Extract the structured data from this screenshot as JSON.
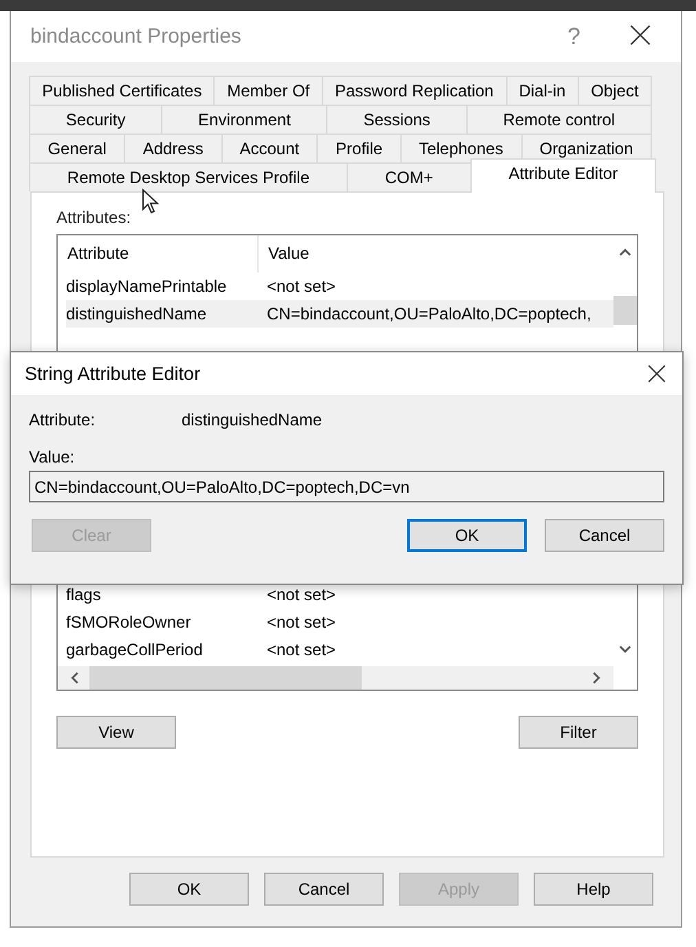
{
  "window": {
    "title": "bindaccount Properties",
    "help_button": "?"
  },
  "tab_rows": [
    {
      "tabs": [
        {
          "label": "Published Certificates",
          "selected": false
        },
        {
          "label": "Member Of",
          "selected": false
        },
        {
          "label": "Password Replication",
          "selected": false
        },
        {
          "label": "Dial-in",
          "selected": false
        },
        {
          "label": "Object",
          "selected": false
        }
      ]
    },
    {
      "tabs": [
        {
          "label": "Security",
          "selected": false
        },
        {
          "label": "Environment",
          "selected": false
        },
        {
          "label": "Sessions",
          "selected": false
        },
        {
          "label": "Remote control",
          "selected": false
        }
      ]
    },
    {
      "tabs": [
        {
          "label": "General",
          "selected": false
        },
        {
          "label": "Address",
          "selected": false
        },
        {
          "label": "Account",
          "selected": false
        },
        {
          "label": "Profile",
          "selected": false
        },
        {
          "label": "Telephones",
          "selected": false
        },
        {
          "label": "Organization",
          "selected": false
        }
      ]
    },
    {
      "tabs": [
        {
          "label": "Remote Desktop Services Profile",
          "selected": false
        },
        {
          "label": "COM+",
          "selected": false
        },
        {
          "label": "Attribute Editor",
          "selected": true
        }
      ]
    }
  ],
  "attributes": {
    "label": "Attributes:",
    "columns": [
      "Attribute",
      "Value"
    ],
    "rows_top": [
      {
        "attribute": "displayNamePrintable",
        "value": "<not set>",
        "selected": false
      },
      {
        "attribute": "distinguishedName",
        "value": "CN=bindaccount,OU=PaloAlto,DC=poptech,",
        "selected": true
      }
    ],
    "rows_bottom": [
      {
        "attribute": "flags",
        "value": "<not set>",
        "selected": false
      },
      {
        "attribute": "fSMORoleOwner",
        "value": "<not set>",
        "selected": false
      },
      {
        "attribute": "garbageCollPeriod",
        "value": "<not set>",
        "selected": false
      }
    ]
  },
  "list_buttons": [
    "View",
    "Filter"
  ],
  "dialog_buttons": [
    {
      "label": "OK",
      "disabled": false
    },
    {
      "label": "Cancel",
      "disabled": false
    },
    {
      "label": "Apply",
      "disabled": true
    },
    {
      "label": "Help",
      "disabled": false
    }
  ],
  "editor": {
    "title": "String Attribute Editor",
    "attribute_label": "Attribute:",
    "attribute_value": "distinguishedName",
    "value_label": "Value:",
    "value": "CN=bindaccount,OU=PaloAlto,DC=poptech,DC=vn",
    "buttons": [
      {
        "label": "Clear",
        "disabled": true,
        "default": false
      },
      {
        "label": "OK",
        "disabled": false,
        "default": true
      },
      {
        "label": "Cancel",
        "disabled": false,
        "default": false
      }
    ]
  }
}
